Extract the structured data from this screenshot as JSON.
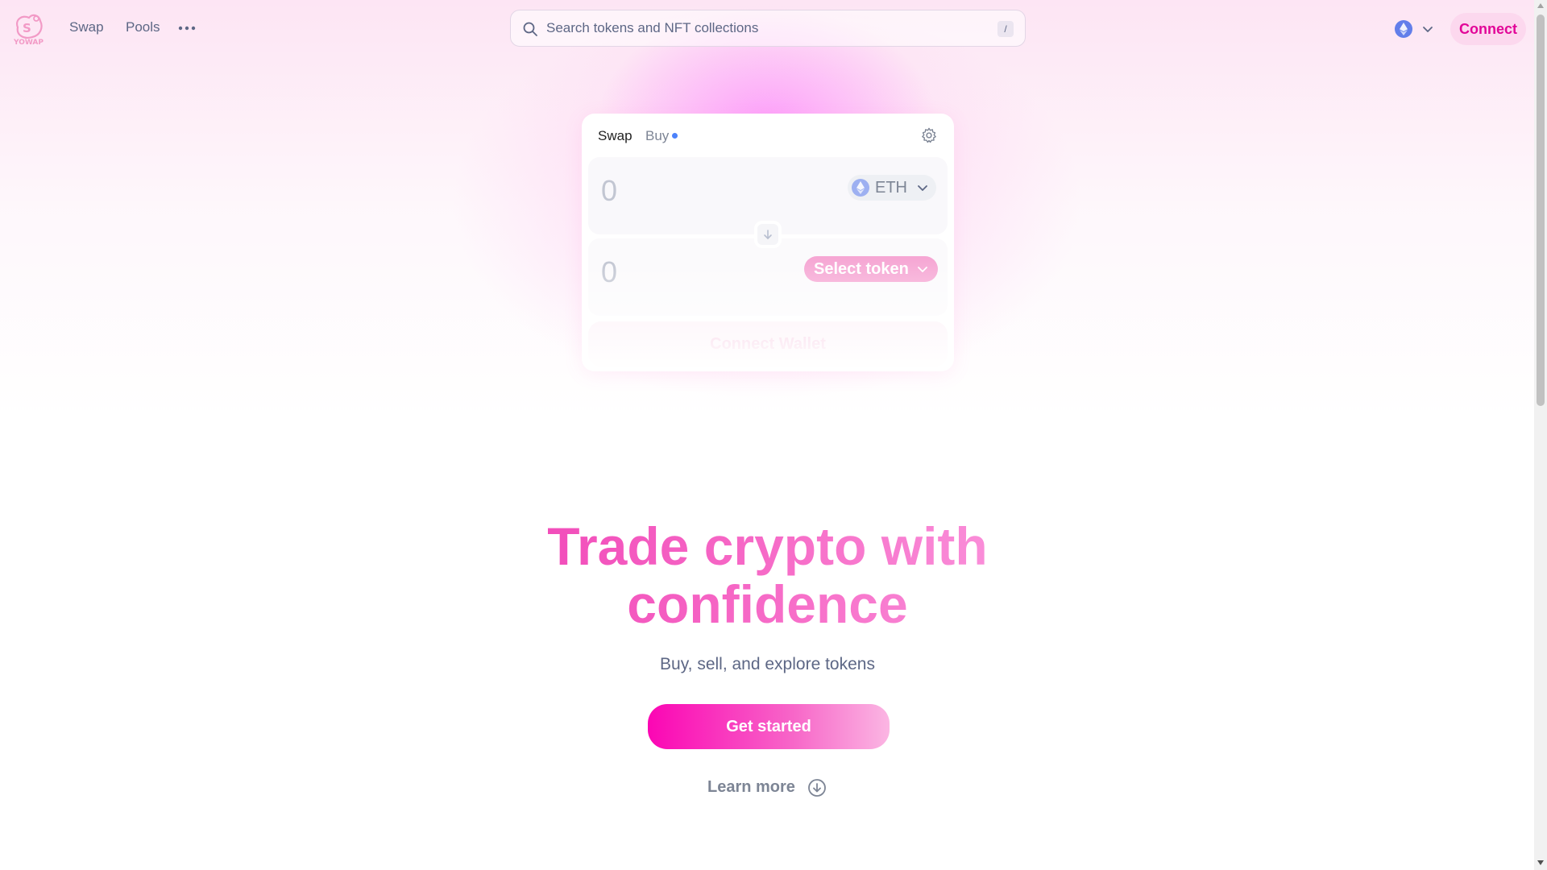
{
  "nav": {
    "logo_text": "YOWAP",
    "links": [
      {
        "label": "Swap"
      },
      {
        "label": "Pools"
      }
    ],
    "more_icon": "ellipsis-icon",
    "connect_label": "Connect"
  },
  "search": {
    "placeholder": "Search tokens and NFT collections",
    "value": "",
    "shortcut": "/"
  },
  "chain": {
    "name_icon": "ethereum-icon",
    "chevron": "chevron-down-icon"
  },
  "swap_card": {
    "tabs": [
      {
        "label": "Swap",
        "active": true
      },
      {
        "label": "Buy",
        "active": false
      }
    ],
    "settings_icon": "gear-icon",
    "sell": {
      "amount_placeholder": "0",
      "token_symbol": "ETH"
    },
    "buy": {
      "amount_placeholder": "0",
      "select_label": "Select token"
    },
    "switch_icon": "arrow-down-icon",
    "connect_wallet_label": "Connect Wallet"
  },
  "hero": {
    "title_line1": "Trade crypto with",
    "title_line2": "confidence",
    "subtitle": "Buy, sell, and explore tokens",
    "cta_label": "Get started",
    "learn_more_label": "Learn more"
  },
  "colors": {
    "accent": "#fc72ff",
    "brand_pink": "#e20698",
    "text_secondary": "#5d6785",
    "text_tertiary": "#7d8595"
  }
}
